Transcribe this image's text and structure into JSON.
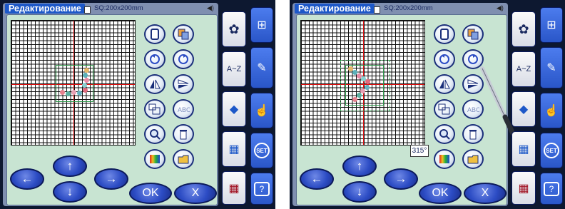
{
  "screens": [
    {
      "title": "Редактирование",
      "hoop": "SQ:200x200mm",
      "tab_az": "A~Z",
      "set_label": "SET",
      "help_label": "?",
      "ok_label": "OK",
      "x_label": "X"
    },
    {
      "title": "Редактирование",
      "hoop": "SQ:200x200mm",
      "tab_az": "A~Z",
      "set_label": "SET",
      "help_label": "?",
      "ok_label": "OK",
      "x_label": "X",
      "rotation": "315°"
    }
  ],
  "icons": {
    "arrows": [
      "arrow-left-icon",
      "arrow-up-icon",
      "arrow-down-icon",
      "arrow-right-icon"
    ],
    "tools": [
      "single-layout-icon",
      "copy-icon",
      "rotate-left-icon",
      "rotate-right-icon",
      "flip-horizontal-icon",
      "flip-vertical-icon",
      "resize-icon",
      "arc-text-icon",
      "zoom-icon",
      "delete-icon",
      "color-icon",
      "save-icon"
    ],
    "side": [
      "embroidery-machine-icon",
      "edit-icon",
      "pattern-icon",
      "settings-icon",
      "help-icon"
    ]
  }
}
